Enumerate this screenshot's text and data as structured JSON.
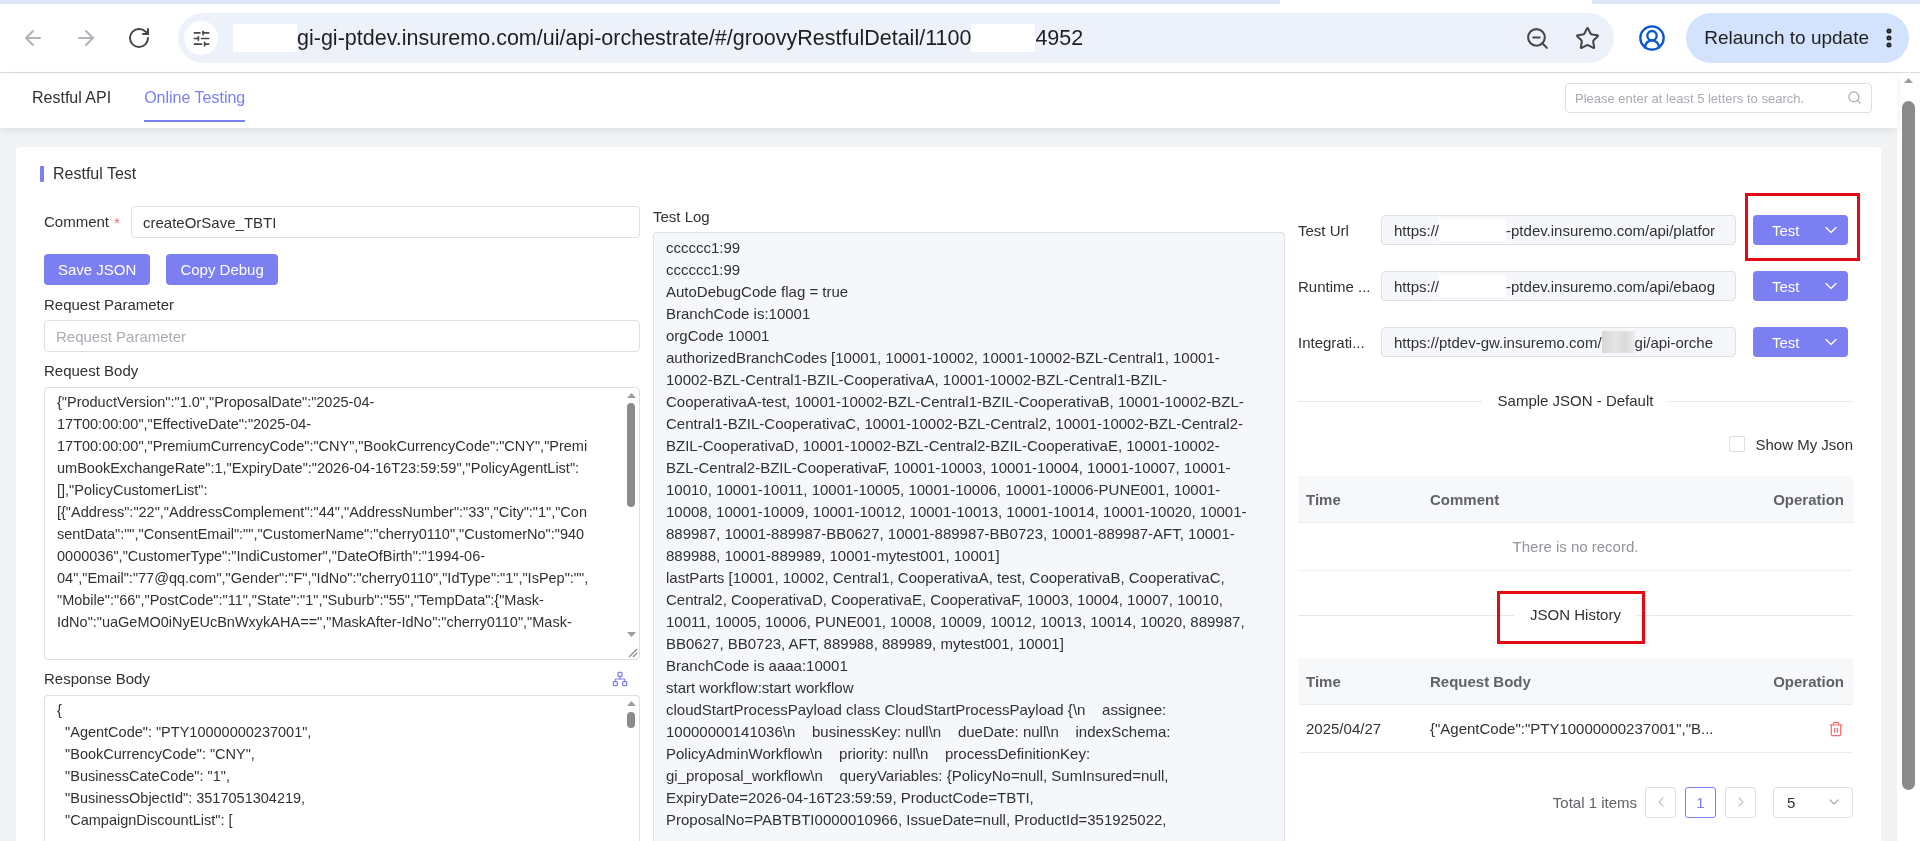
{
  "browser": {
    "nav_buttons": [
      {
        "kind": "back",
        "disabled": true
      },
      {
        "kind": "forward",
        "disabled": true
      },
      {
        "kind": "reload",
        "disabled": false
      }
    ],
    "address_bar": {
      "segments": [
        {
          "kind": "redacted"
        },
        {
          "kind": "text",
          "text": "gi-gi-ptdev.insuremo.com/ui/api-orchestrate/#/groovyRestfulDetail/1100"
        },
        {
          "kind": "redacted"
        },
        {
          "kind": "text",
          "text": "4952"
        }
      ]
    },
    "update_button": {
      "label": "Relaunch to update"
    }
  },
  "nav_tabs": [
    {
      "label": "Restful API",
      "selected": false
    },
    {
      "label": "Online Testing",
      "selected": true
    }
  ],
  "search": {
    "placeholder": "Please enter at least 5 letters to search."
  },
  "panel": {
    "title": "Restful Test",
    "comment": {
      "label": "Comment",
      "required_mark": "*",
      "value": "createOrSave_TBTI"
    },
    "buttons": [
      "Save JSON",
      "Copy Debug"
    ],
    "request_parameter": {
      "label": "Request Parameter",
      "placeholder": "Request Parameter"
    },
    "request_body": {
      "label": "Request Body",
      "value": "{\"ProductVersion\":\"1.0\",\"ProposalDate\":\"2025-04-17T00:00:00\",\"EffectiveDate\":\"2025-04-17T00:00:00\",\"PremiumCurrencyCode\":\"CNY\",\"BookCurrencyCode\":\"CNY\",\"PremiumBookExchangeRate\":1,\"ExpiryDate\":\"2026-04-16T23:59:59\",\"PolicyAgentList\":[],\"PolicyCustomerList\":[{\"Address\":\"22\",\"AddressComplement\":\"44\",\"AddressNumber\":\"33\",\"City\":\"1\",\"ConsentData\":\"\",\"ConsentEmail\":\"\",\"CustomerName\":\"cherry0110\",\"CustomerNo\":\"9400000036\",\"CustomerType\":\"IndiCustomer\",\"DateOfBirth\":\"1994-06-04\",\"Email\":\"77@qq.com\",\"Gender\":\"F\",\"IdNo\":\"cherry0110\",\"IdType\":\"1\",\"IsPep\":\"\",\"Mobile\":\"66\",\"PostCode\":\"11\",\"State\":\"1\",\"Suburb\":\"55\",\"TempData\":{\"Mask-IdNo\":\"uaGeMO0iNyEUcBnWxykAHA==\",\"MaskAfter-IdNo\":\"cherry0110\",\"Mask-"
    },
    "response_body": {
      "label": "Response Body",
      "lines": [
        "{",
        "  \"AgentCode\": \"PTY10000000237001\",",
        "  \"BookCurrencyCode\": \"CNY\",",
        "  \"BusinessCateCode\": \"1\",",
        "  \"BusinessObjectId\": 3517051304219,",
        "  \"CampaignDiscountList\": ["
      ]
    },
    "test_log": {
      "label": "Test Log",
      "entries": [
        "cccccc1:99",
        "cccccc1:99",
        "AutoDebugCode flag = true",
        "BranchCode is:10001",
        "orgCode 10001",
        "authorizedBranchCodes [10001, 10001-10002, 10001-10002-BZL-Central1, 10001-10002-BZL-Central1-BZIL-CooperativaA, 10001-10002-BZL-Central1-BZIL-CooperativaA-test, 10001-10002-BZL-Central1-BZIL-CooperativaB, 10001-10002-BZL-Central1-BZIL-CooperativaC, 10001-10002-BZL-Central2, 10001-10002-BZL-Central2-BZIL-CooperativaD, 10001-10002-BZL-Central2-BZIL-CooperativaE, 10001-10002-BZL-Central2-BZIL-CooperativaF, 10001-10003, 10001-10004, 10001-10007, 10001-10010, 10001-10011, 10001-10005, 10001-10006, 10001-10006-PUNE001, 10001-10008, 10001-10009, 10001-10012, 10001-10013, 10001-10014, 10001-10020, 10001-889987, 10001-889987-BB0627, 10001-889987-BB0723, 10001-889987-AFT, 10001-889988, 10001-889989, 10001-mytest001, 10001]",
        "lastParts [10001, 10002, Central1, CooperativaA, test, CooperativaB, CooperativaC, Central2, CooperativaD, CooperativaE, CooperativaF, 10003, 10004, 10007, 10010, 10011, 10005, 10006, PUNE001, 10008, 10009, 10012, 10013, 10014, 10020, 889987, BB0627, BB0723, AFT, 889988, 889989, mytest001, 10001]",
        "BranchCode is aaaa:10001",
        "start workflow:start workflow",
        "cloudStartProcessPayload class CloudStartProcessPayload {\\n    assignee: 10000000141036\\n    businessKey: null\\n    dueDate: null\\n    indexSchema: PolicyAdminWorkflow\\n    priority: null\\n    processDefinitionKey: gi_proposal_workflow\\n    queryVariables: {PolicyNo=null, SumInsured=null, ExpiryDate=2026-04-16T23:59:59, ProductCode=TBTI, ProposalNo=PABTBTI0000010966, IssueDate=null, ProductId=351925022,"
      ]
    },
    "endpoints": [
      {
        "label": "Test Url",
        "url": [
          {
            "kind": "text",
            "text": "https://"
          },
          {
            "kind": "redacted"
          },
          {
            "kind": "text",
            "text": "-ptdev.insuremo.com/api/platfor"
          }
        ],
        "button": "Test",
        "highlighted": true
      },
      {
        "label": "Runtime ...",
        "url": [
          {
            "kind": "text",
            "text": "https://"
          },
          {
            "kind": "redacted"
          },
          {
            "kind": "text",
            "text": "-ptdev.insuremo.com/api/ebaog"
          }
        ],
        "button": "Test",
        "highlighted": false
      },
      {
        "label": "Integrati...",
        "url": [
          {
            "kind": "text",
            "text": "https://ptdev-gw.insuremo.com/"
          },
          {
            "kind": "blurred"
          },
          {
            "kind": "text",
            "text": "gi/api-orche"
          }
        ],
        "button": "Test",
        "highlighted": false
      }
    ],
    "sample_json": {
      "title": "Sample JSON - Default",
      "show_my_json": {
        "label": "Show My Json",
        "checked": false
      },
      "columns": [
        "Time",
        "Comment",
        "Operation"
      ],
      "empty_text": "There is no record."
    },
    "json_history": {
      "title": "JSON History",
      "highlighted": true,
      "columns": [
        "Time",
        "Request Body",
        "Operation"
      ],
      "rows": [
        {
          "time": "2025/04/27",
          "request_body": "{\"AgentCode\":\"PTY10000000237001\",\"B..."
        }
      ],
      "pagination": {
        "total": "Total 1 items",
        "prev_disabled": true,
        "pages": [
          {
            "label": "1",
            "selected": true
          }
        ],
        "next_disabled": true,
        "page_size": "5"
      }
    }
  }
}
